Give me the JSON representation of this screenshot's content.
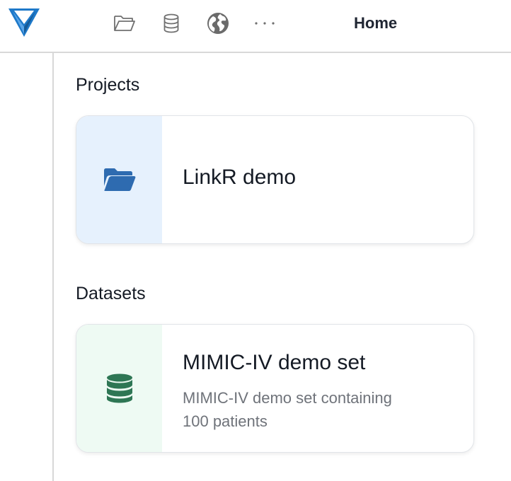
{
  "app": {
    "logo_icon": "triangle-logo",
    "brand_color": "#1e79c9"
  },
  "nav": {
    "items": [
      {
        "icon": "folder-open-icon",
        "label": "Projects"
      },
      {
        "icon": "database-icon",
        "label": "Datasets"
      },
      {
        "icon": "globe-icon",
        "label": "Web"
      },
      {
        "icon": "more-horizontal-icon",
        "label": "More"
      }
    ]
  },
  "header": {
    "title": "Home"
  },
  "projects": {
    "section_title": "Projects",
    "items": [
      {
        "name": "LinkR demo",
        "icon": "folder-open-icon",
        "icon_color": "#2e6bb0",
        "bg_color": "#e6f1fd"
      }
    ]
  },
  "datasets": {
    "section_title": "Datasets",
    "items": [
      {
        "name": "MIMIC-IV demo set",
        "description": "MIMIC-IV demo set containing 100 patients",
        "icon": "database-icon",
        "icon_color": "#2e7654",
        "bg_color": "#eefaf3"
      }
    ]
  }
}
